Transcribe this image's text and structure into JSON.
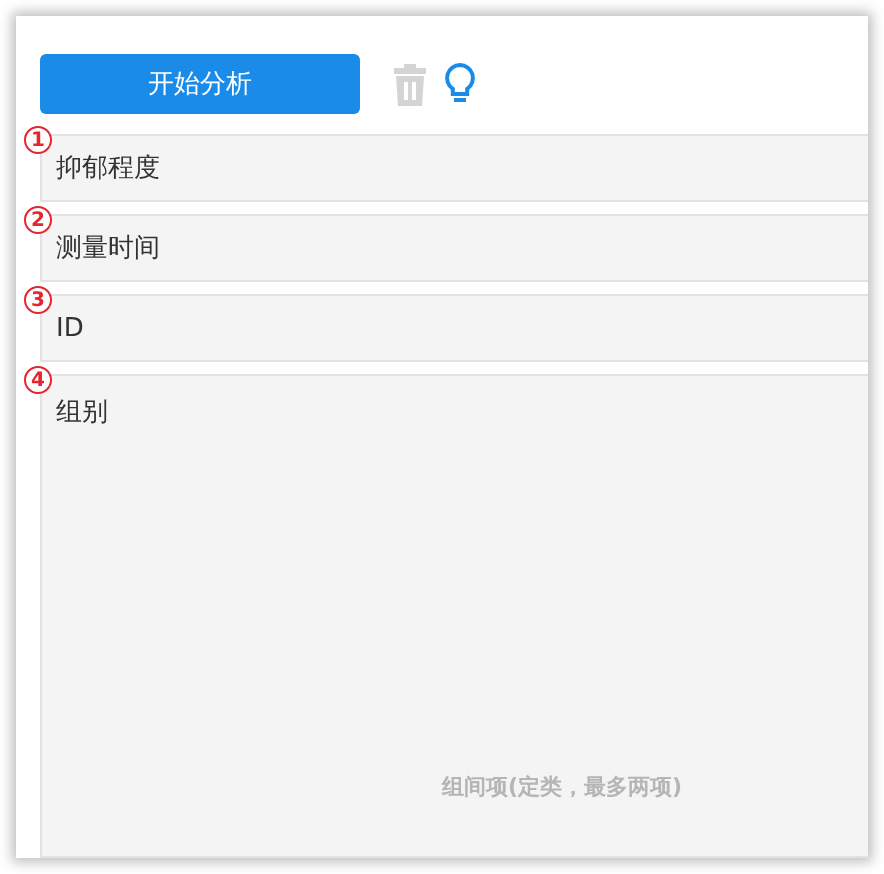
{
  "toolbar": {
    "start_button": "开始分析"
  },
  "fields": [
    {
      "number": "1",
      "label": "抑郁程度"
    },
    {
      "number": "2",
      "label": "测量时间"
    },
    {
      "number": "3",
      "label": "ID"
    },
    {
      "number": "4",
      "label": "组别",
      "hint": "组间项(定类，最多两项)"
    }
  ]
}
